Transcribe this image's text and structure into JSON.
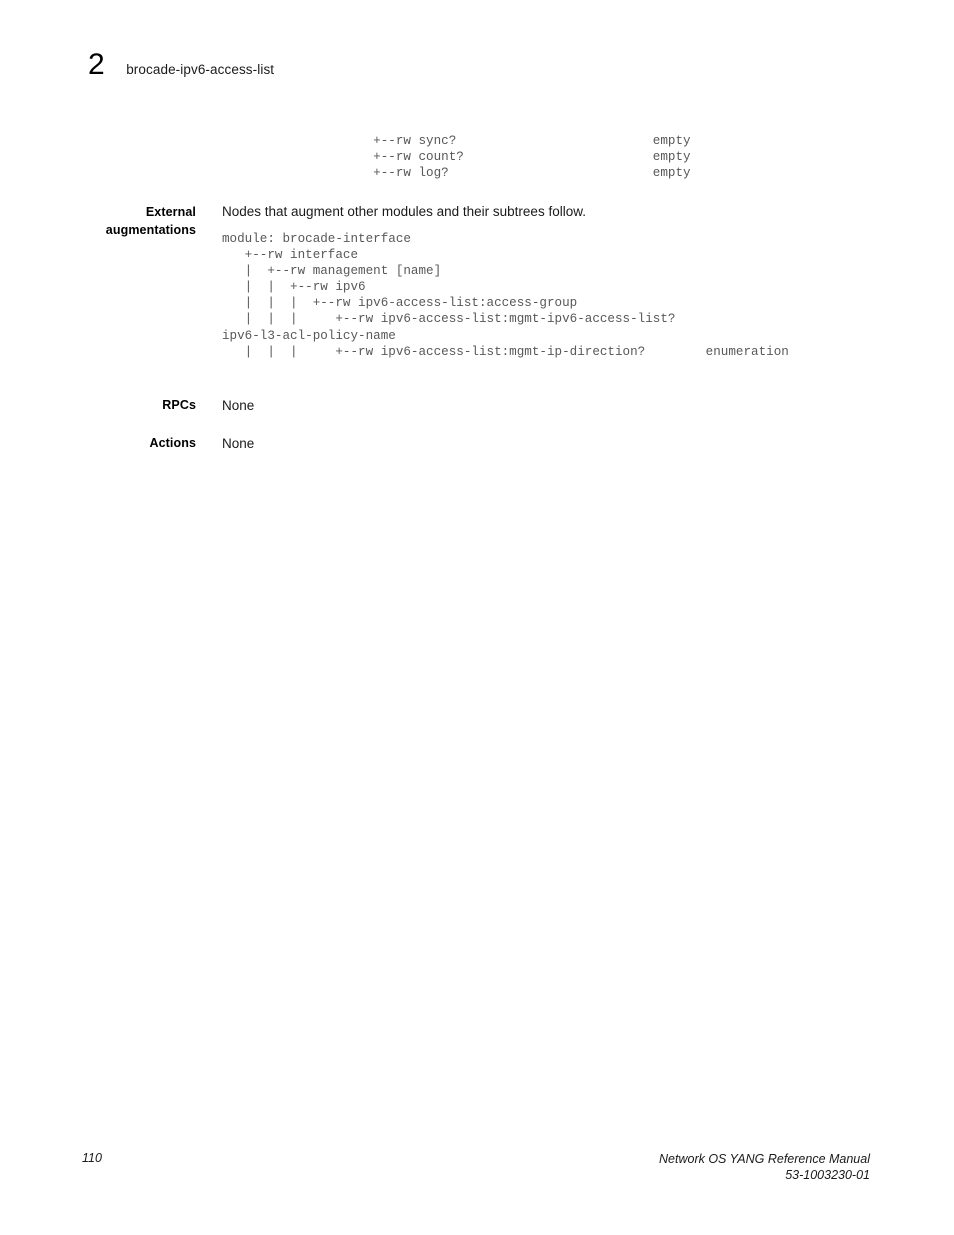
{
  "header": {
    "chapter_number": "2",
    "chapter_title": "brocade-ipv6-access-list"
  },
  "top_code_fragment": "                    +--rw sync?                          empty\n                    +--rw count?                         empty\n                    +--rw log?                           empty",
  "sections": {
    "external_augmentations": {
      "label_line1": "External",
      "label_line2": "augmentations",
      "description": "Nodes that augment other modules and their subtrees follow.",
      "code": "module: brocade-interface\n   +--rw interface\n   |  +--rw management [name]\n   |  |  +--rw ipv6\n   |  |  |  +--rw ipv6-access-list:access-group\n   |  |  |     +--rw ipv6-access-list:mgmt-ipv6-access-list?\nipv6-l3-acl-policy-name\n   |  |  |     +--rw ipv6-access-list:mgmt-ip-direction?        enumeration"
    },
    "rpcs": {
      "label": "RPCs",
      "value": "None"
    },
    "actions": {
      "label": "Actions",
      "value": "None"
    }
  },
  "footer": {
    "page_number": "110",
    "manual_title": "Network OS YANG Reference Manual",
    "document_number": "53-1003230-01"
  }
}
